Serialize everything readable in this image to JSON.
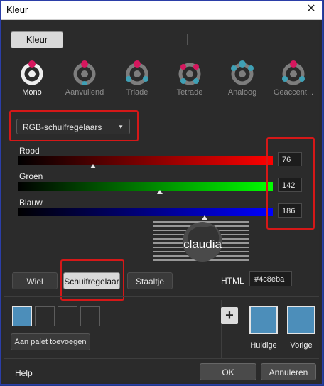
{
  "window": {
    "title": "Kleur",
    "close_icon": "close-icon"
  },
  "top_button": "Kleur",
  "schemes": [
    {
      "label": "Mono",
      "active": true,
      "icon": "mono-scheme-icon"
    },
    {
      "label": "Aanvullend",
      "active": false,
      "icon": "complementary-scheme-icon"
    },
    {
      "label": "Triade",
      "active": false,
      "icon": "triad-scheme-icon"
    },
    {
      "label": "Tetrade",
      "active": false,
      "icon": "tetrad-scheme-icon"
    },
    {
      "label": "Analoog",
      "active": false,
      "icon": "analogous-scheme-icon"
    },
    {
      "label": "Geaccent...",
      "active": false,
      "icon": "accented-scheme-icon"
    }
  ],
  "mode_dropdown": {
    "value": "RGB-schuifregelaars"
  },
  "sliders": [
    {
      "label": "Rood",
      "value": "76",
      "color": "#ff0000"
    },
    {
      "label": "Groen",
      "value": "142",
      "color": "#00ff00"
    },
    {
      "label": "Blauw",
      "value": "186",
      "color": "#0000ff"
    }
  ],
  "watermark_text": "claudia",
  "tabs": [
    {
      "label": "Wiel",
      "selected": false
    },
    {
      "label": "Schuifregelaar",
      "selected": true
    },
    {
      "label": "Staaltje",
      "selected": false
    }
  ],
  "html": {
    "label": "HTML",
    "value": "#4c8eba"
  },
  "palette": {
    "swatch_colors": [
      "#4c8eba",
      "",
      "",
      ""
    ],
    "add_label": "Aan palet toevoegen"
  },
  "current": {
    "label": "Huidige",
    "color": "#4c8eba"
  },
  "previous": {
    "label": "Vorige",
    "color": "#4c8eba"
  },
  "footer": {
    "help": "Help",
    "ok": "OK",
    "cancel": "Annuleren"
  },
  "colors": {
    "highlight": "#d51818",
    "accent": "#d6175e",
    "teal": "#3fa0b5"
  }
}
